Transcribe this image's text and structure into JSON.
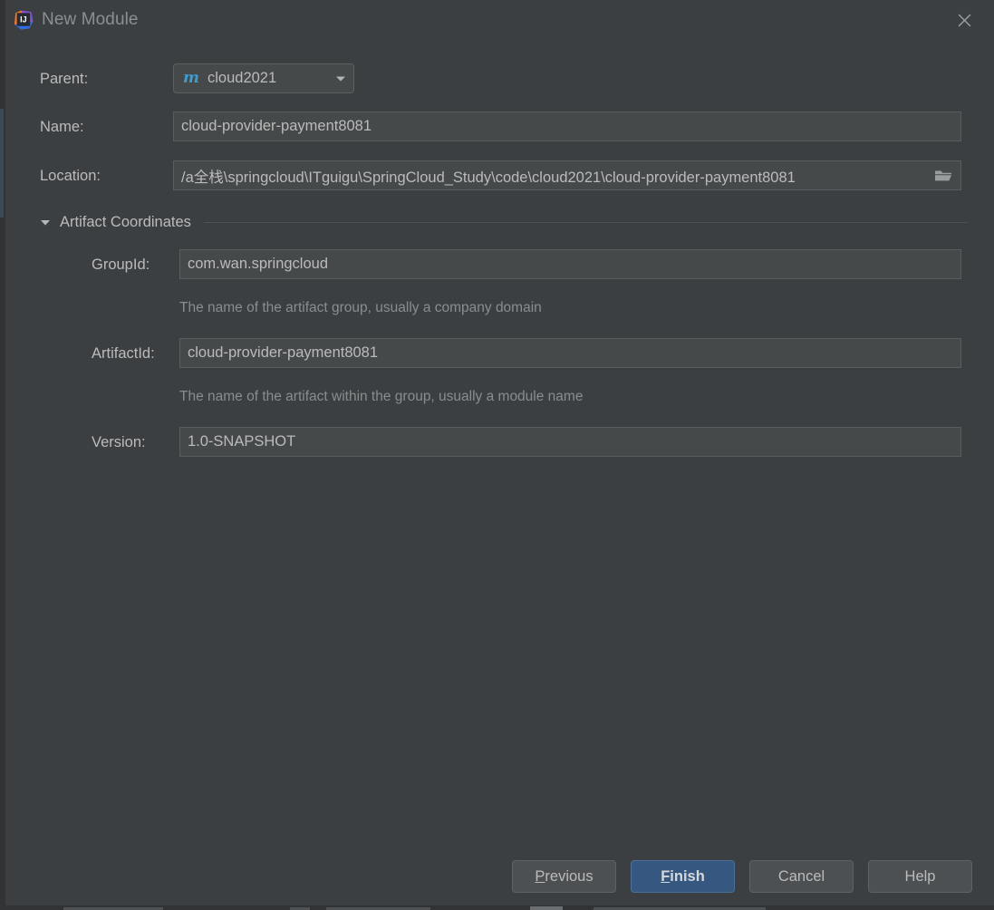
{
  "window": {
    "title": "New Module",
    "app_icon": "intellij-idea-icon",
    "close_icon": "close-icon"
  },
  "form": {
    "parent": {
      "label": "Parent:",
      "icon": "maven-module-icon",
      "value": "cloud2021",
      "arrow_icon": "chevron-down-icon"
    },
    "name": {
      "label": "Name:",
      "value": "cloud-provider-payment8081"
    },
    "location": {
      "label": "Location:",
      "value": "/a全栈\\springcloud\\ITguigu\\SpringCloud_Study\\code\\cloud2021\\cloud-provider-payment8081",
      "browse_icon": "folder-open-icon"
    }
  },
  "artifact_coordinates": {
    "section_title": "Artifact Coordinates",
    "expanded_icon": "triangle-down-icon",
    "group_id": {
      "label": "GroupId:",
      "value": "com.wan.springcloud",
      "hint": "The name of the artifact group, usually a company domain"
    },
    "artifact_id": {
      "label": "ArtifactId:",
      "value": "cloud-provider-payment8081",
      "hint": "The name of the artifact within the group, usually a module name"
    },
    "version": {
      "label": "Version:",
      "value": "1.0-SNAPSHOT"
    }
  },
  "buttons": {
    "previous": {
      "mnemonic": "P",
      "rest": "revious"
    },
    "finish": {
      "mnemonic": "F",
      "rest": "inish"
    },
    "cancel": {
      "label": "Cancel"
    },
    "help": {
      "label": "Help"
    }
  },
  "colors": {
    "dialog_bg": "#3c3f41",
    "field_bg": "#45494a",
    "text": "#bbbbbb",
    "hint_text": "#8a8d8f",
    "default_button": "#365880",
    "maven_icon": "#3f9bd0"
  }
}
